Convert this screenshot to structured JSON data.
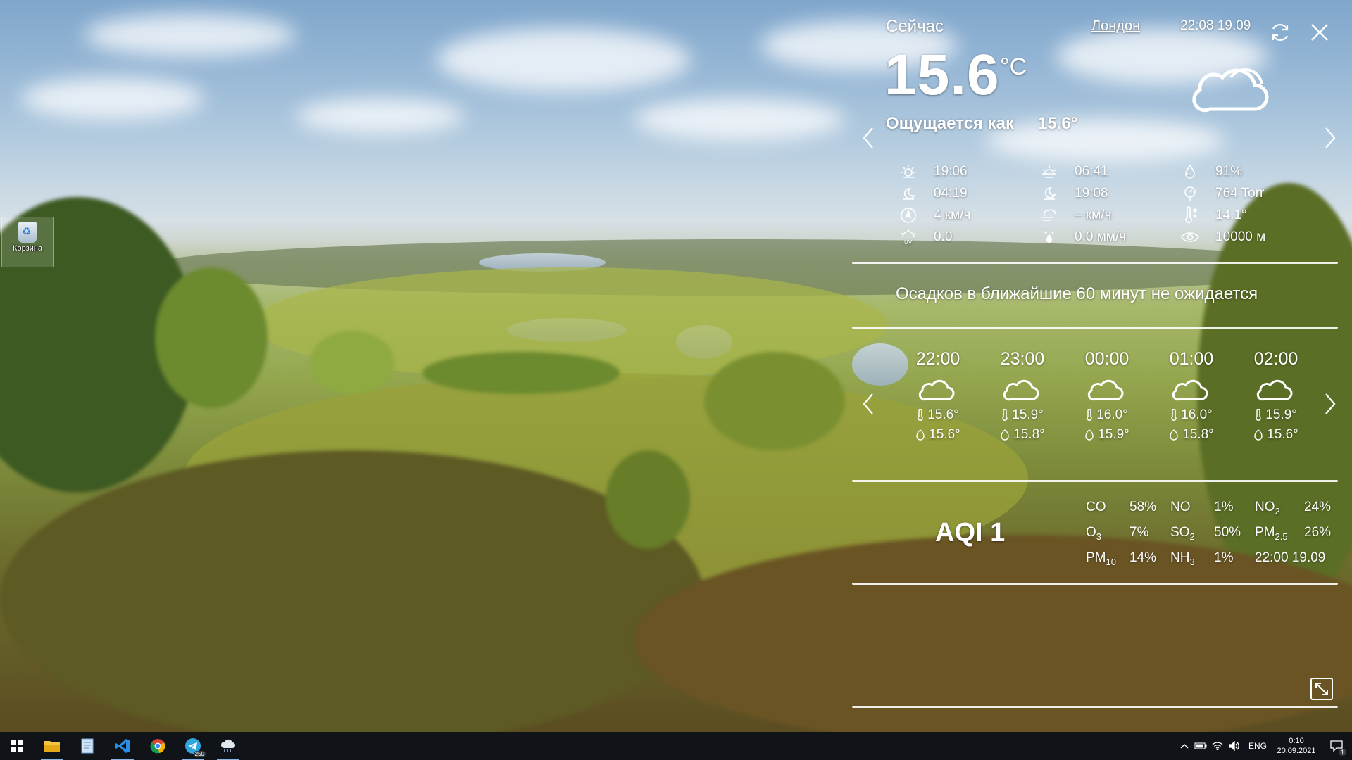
{
  "desktop": {
    "recycle_bin_label": "Корзина"
  },
  "widget": {
    "now_label": "Сейчас",
    "city": "Лондон",
    "datetime": "22:08 19.09",
    "temperature": "15.6",
    "temp_unit": "°C",
    "feels_label": "Ощущается как",
    "feels_value": "15.6°",
    "details": {
      "sunset": "19:06",
      "moonrise": "04:19",
      "wind": "4 км/ч",
      "uv": "0.0",
      "sunrise": "06:41",
      "moonset": "19:08",
      "gust": "– км/ч",
      "precip": "0.0 мм/ч",
      "humidity": "91%",
      "pressure": "764 Torr",
      "dew_point": "14.1°",
      "visibility": "10000 м"
    },
    "precip_forecast": "Осадков в ближайшие 60 минут не ожидается",
    "hourly": [
      {
        "time": "22:00",
        "temp": "15.6°",
        "feels": "15.6°",
        "icon": "cloud-icon"
      },
      {
        "time": "23:00",
        "temp": "15.9°",
        "feels": "15.8°",
        "icon": "cloud-icon"
      },
      {
        "time": "00:00",
        "temp": "16.0°",
        "feels": "15.9°",
        "icon": "cloud-icon"
      },
      {
        "time": "01:00",
        "temp": "16.0°",
        "feels": "15.8°",
        "icon": "cloud-icon"
      },
      {
        "time": "02:00",
        "temp": "15.9°",
        "feels": "15.6°",
        "icon": "cloud-icon"
      }
    ],
    "air": {
      "aqi": "AQI 1",
      "co_label": "CO",
      "co": "58%",
      "no_label": "NO",
      "no": "1%",
      "no2_label": "NO",
      "no2_sub": "2",
      "no2": "24%",
      "o3_label": "O",
      "o3_sub": "3",
      "o3": "7%",
      "so2_label": "SO",
      "so2_sub": "2",
      "so2": "50%",
      "pm25_label": "PM",
      "pm25_sub": "2.5",
      "pm25": "26%",
      "pm10_label": "PM",
      "pm10_sub": "10",
      "pm10": "14%",
      "nh3_label": "NH",
      "nh3_sub": "3",
      "nh3": "1%",
      "updated": "22:00 19.09"
    }
  },
  "taskbar": {
    "lang": "ENG",
    "clock_time": "0:10",
    "clock_date": "20.09.2021",
    "notification_count": "1",
    "telegram_badge": "250"
  }
}
